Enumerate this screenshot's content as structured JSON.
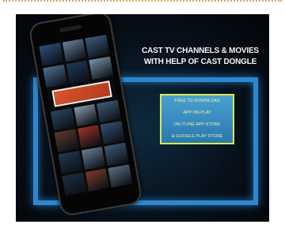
{
  "headline": {
    "line1": "CAST TV CHANNELS & MOVIES",
    "line2": "WITH HELP OF CAST DONGLE"
  },
  "info_box": {
    "lines": [
      "FREE TO DOWNLOAD",
      "APP ON PLAY",
      "ON ITUNE APP STORE",
      "& GOOGLE PLAY STORE"
    ]
  },
  "colors": {
    "frame_blue": "#2f86cc",
    "info_fill": "#3a8cc0",
    "info_border": "#d7e95a",
    "featured_thumb": "#d9542a",
    "background": "#07101a"
  },
  "phone": {
    "thumb_colors": [
      "#2d4f7a",
      "#6a7f97",
      "#3d5b7e",
      "#4e6f8f",
      "#1e3a5a",
      "#7a8fa5",
      "#2b4561",
      "#8a99ab",
      "#3f5c78",
      "#5b3a2a",
      "#9a3428",
      "#33506d",
      "#23384f",
      "#6b7e92",
      "#405a74",
      "#1d2f42",
      "#7a3a2c",
      "#5a6d80"
    ]
  }
}
